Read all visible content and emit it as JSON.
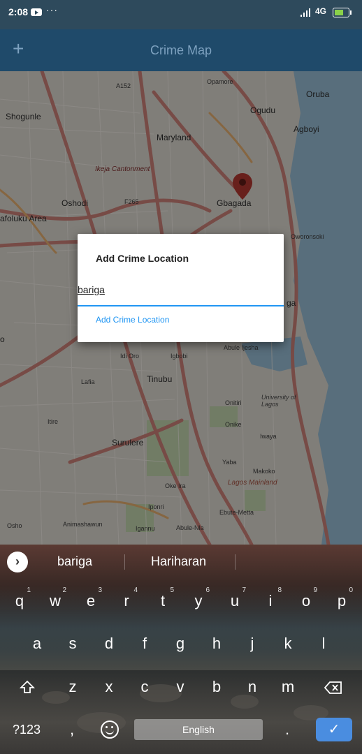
{
  "status_bar": {
    "time": "2:08",
    "youtube_icon": "youtube-icon",
    "more_dots": "···",
    "network": "4G",
    "battery_icon": "battery-charging-icon"
  },
  "app_bar": {
    "add_icon": "+",
    "title": "Crime Map"
  },
  "map": {
    "labels": [
      "Opamore",
      "Oruba",
      "A152",
      "Shogunle",
      "Ogudu",
      "Agboyi",
      "Maryland",
      "Ikeja Cantonment",
      "Oshodi",
      "F265",
      "Gbagada",
      "afoluku Area",
      "Oworonsoki",
      "Idi Oro",
      "Igbobi",
      "Abule Ijesha",
      "Lafia",
      "Tinubu",
      "Onitiri",
      "University of Lagos",
      "Itire",
      "Onike",
      "Iwaya",
      "Surulere",
      "Yaba",
      "Makoko",
      "Lagos Mainland",
      "Oke Ira",
      "Iponri",
      "Ebute-Metta",
      "Osho",
      "Animashawun",
      "Igannu",
      "Abule-Nla",
      "ga",
      "o"
    ],
    "pin_icon": "map-pin-icon"
  },
  "dialog": {
    "title": "Add Crime Location",
    "input_value": "bariga",
    "action_label": "Add Crime Location"
  },
  "keyboard": {
    "suggestions": [
      "bariga",
      "Hariharan"
    ],
    "row1": [
      {
        "key": "q",
        "hint": "1"
      },
      {
        "key": "w",
        "hint": "2"
      },
      {
        "key": "e",
        "hint": "3"
      },
      {
        "key": "r",
        "hint": "4"
      },
      {
        "key": "t",
        "hint": "5"
      },
      {
        "key": "y",
        "hint": "6"
      },
      {
        "key": "u",
        "hint": "7"
      },
      {
        "key": "i",
        "hint": "8"
      },
      {
        "key": "o",
        "hint": "9"
      },
      {
        "key": "p",
        "hint": "0"
      }
    ],
    "row2": [
      "a",
      "s",
      "d",
      "f",
      "g",
      "h",
      "j",
      "k",
      "l"
    ],
    "row3": [
      "z",
      "x",
      "c",
      "v",
      "b",
      "n",
      "m"
    ],
    "symbols_label": "?123",
    "comma": ",",
    "space_label": "English",
    "period": ".",
    "shift_icon": "shift-icon",
    "backspace_icon": "backspace-icon",
    "emoji_icon": "emoji-icon",
    "done_icon": "checkmark-icon"
  }
}
